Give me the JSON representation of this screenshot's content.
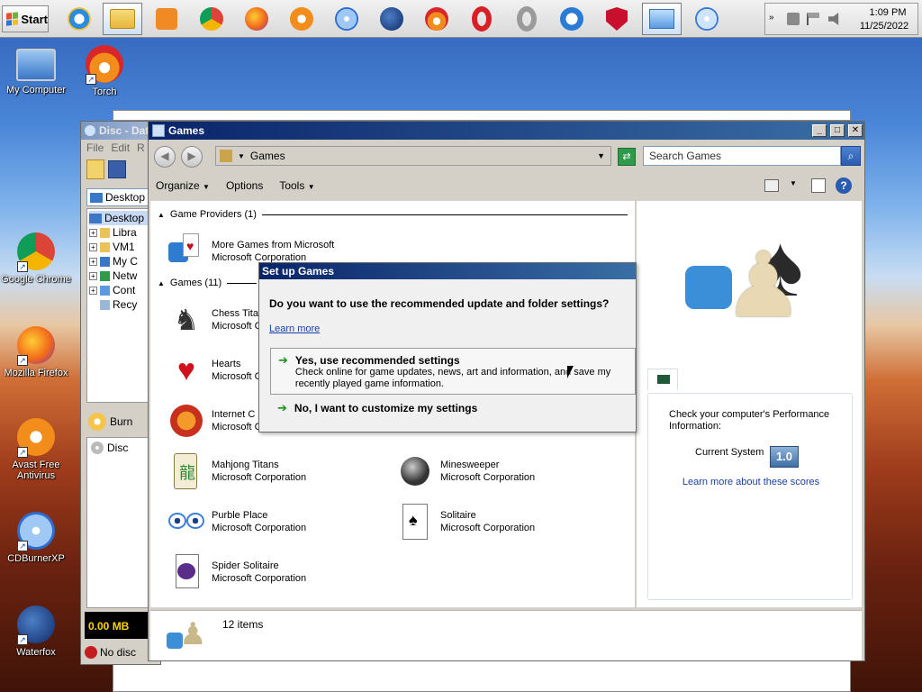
{
  "taskbar": {
    "start_label": "Start",
    "clock_time": "1:09 PM",
    "clock_date": "11/25/2022",
    "overflow_chevron": "»"
  },
  "desktop_icons": [
    {
      "label": "My Computer"
    },
    {
      "label": "Torch"
    },
    {
      "label": "Google Chrome"
    },
    {
      "label": "Mozilla Firefox"
    },
    {
      "label": "Avast Free Antivirus"
    },
    {
      "label": "CDBurnerXP"
    },
    {
      "label": "Waterfox"
    }
  ],
  "disc_window": {
    "title": "Disc - Dat",
    "menu": [
      "File",
      "Edit",
      "R"
    ],
    "location": "Desktop",
    "tree": [
      "Desktop",
      "Libra",
      "VM1",
      "My C",
      "Netw",
      "Cont",
      "Recy"
    ],
    "burn_label": "Burn",
    "disc_label": "Disc",
    "size_label": "0.00 MB",
    "no_disc_label": "No disc"
  },
  "games_window": {
    "title": "Games",
    "address": "Games",
    "search_placeholder": "Search Games",
    "toolbar": {
      "organize": "Organize",
      "options": "Options",
      "tools": "Tools"
    },
    "providers_header": "Game Providers (1)",
    "provider": {
      "name": "More Games from Microsoft",
      "publisher": "Microsoft Corporation"
    },
    "games_header": "Games (11)",
    "games": [
      {
        "name": "Chess Tita",
        "publisher": "Microsoft C"
      },
      {
        "name": "Hearts",
        "publisher": "Microsoft C"
      },
      {
        "name": "Internet C",
        "publisher": "Microsoft C"
      },
      {
        "name": "Mahjong Titans",
        "publisher": "Microsoft Corporation"
      },
      {
        "name": "Minesweeper",
        "publisher": "Microsoft Corporation"
      },
      {
        "name": "Purble Place",
        "publisher": "Microsoft Corporation"
      },
      {
        "name": "Solitaire",
        "publisher": "Microsoft Corporation"
      },
      {
        "name": "Spider Solitaire",
        "publisher": "Microsoft Corporation"
      }
    ],
    "perf": {
      "heading": "Check your computer's Performance Information:",
      "current_label": "Current System",
      "score": "1.0",
      "learn_more": "Learn more about these scores"
    },
    "status_count": "12 items"
  },
  "setup_dialog": {
    "title": "Set up Games",
    "question": "Do you want to use the recommended update and folder settings?",
    "learn_more": "Learn more",
    "option_yes_title": "Yes, use recommended settings",
    "option_yes_desc": "Check online for game updates, news, art and information, and save my recently played game information.",
    "option_no_title": "No, I want to customize my settings"
  }
}
